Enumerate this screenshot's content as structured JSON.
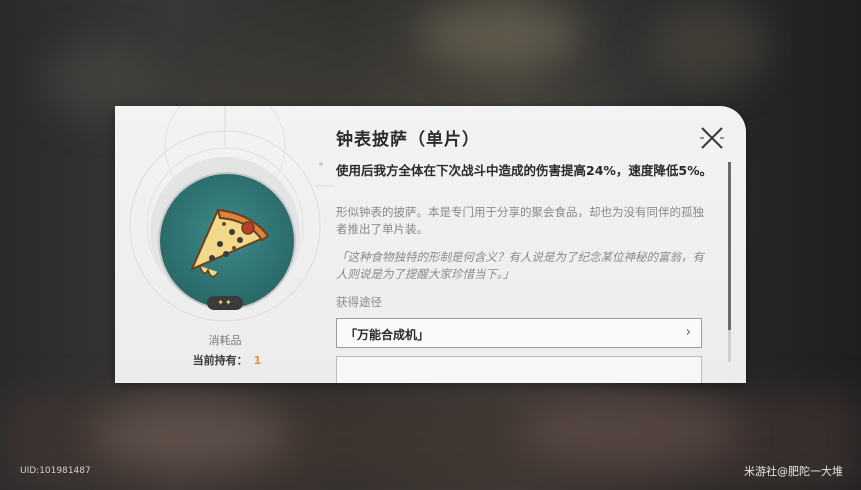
{
  "item": {
    "title": "钟表披萨（单片）",
    "effect": "使用后我方全体在下次战斗中造成的伤害提高24%，速度降低5%。",
    "description": "形似钟表的披萨。本是专门用于分享的聚会食品，却也为没有同伴的孤独者推出了单片装。",
    "quote": "「这种食物独特的形制是何含义？有人说是为了纪念某位神秘的富翁，有人则说是为了提醒大家珍惜当下。」",
    "rarity_stars": "✦✦",
    "category": "消耗品",
    "owned_label": "当前持有：",
    "owned_count": "1"
  },
  "source": {
    "label": "获得途径",
    "items": [
      {
        "label": "「万能合成机」",
        "chevron": "›"
      }
    ]
  },
  "footer": {
    "uid": "UID:101981487",
    "watermark": "米游社@肥陀一大堆"
  },
  "colors": {
    "accent": "#e2962e",
    "item_bg": "#2d6f6e"
  }
}
